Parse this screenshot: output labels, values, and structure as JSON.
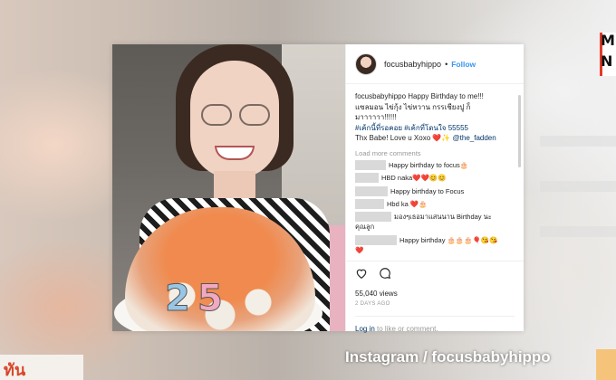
{
  "post": {
    "username": "focusbabyhippo",
    "separator": "•",
    "follow_label": "Follow",
    "caption": {
      "username": "focusbabyhippo",
      "line1": "Happy Birthday to me!!!",
      "line2": "แซลมอน ไข่กุ้ง ไข่หวาน กรรเชียงปู ก็",
      "line3": "มาาาาาา!!!!!!",
      "hashtags": "#เค้กนี้ที่รอคอย #เค้กที่โดนใจ 55555",
      "line5_text": "Thx Babe! Love u Xoxo ❤️✨",
      "mention": "@the_fadden"
    },
    "load_more": "Load more comments",
    "comments": [
      {
        "text": "Happy birthday to focus🎂"
      },
      {
        "text": "HBD naka❤️❤️😊😊"
      },
      {
        "text": "Happy birthday to Focus"
      },
      {
        "text": "Hbd ka ❤️🎂"
      },
      {
        "text": "มองๆเธอมาแสนนาน Birthday นะ"
      },
      {
        "text": "คุณลูก"
      },
      {
        "text": "Happy birthday 🎂🎂🎂🎈😘😘"
      },
      {
        "text": "❤️"
      }
    ],
    "views": "55,040 views",
    "time_ago": "2 DAYS AGO",
    "login_link": "Log in",
    "login_rest": " to like or comment.",
    "icons": {
      "like": "heart-icon",
      "comment": "comment-bubble-icon"
    }
  },
  "media": {
    "cake_numbers": [
      "2",
      "5"
    ]
  },
  "overlay": {
    "credit": "Instagram / focusbabyhippo",
    "channel_logo_top": "M",
    "channel_logo_bottom": "N",
    "brand_bottom_left": "ทัน"
  }
}
